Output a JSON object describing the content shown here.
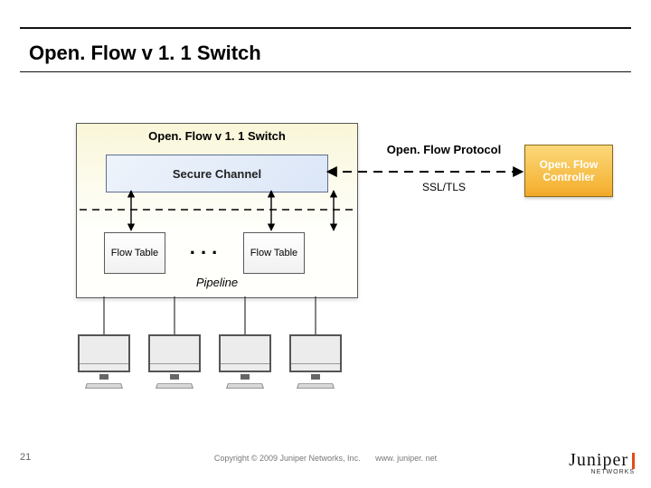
{
  "title": "Open. Flow v 1. 1 Switch",
  "switch": {
    "title": "Open. Flow v 1. 1 Switch",
    "secure_channel": "Secure Channel",
    "flow_table1": "Flow Table",
    "dots": ". . .",
    "flow_table2": "Flow Table",
    "pipeline": "Pipeline"
  },
  "protocol": {
    "label": "Open. Flow Protocol",
    "ssl": "SSL/TLS"
  },
  "controller": "Open. Flow Controller",
  "footer": {
    "page": "21",
    "copyright": "Copyright © 2009 Juniper Networks, Inc.",
    "url": "www. juniper. net",
    "logo_name": "Juniper",
    "logo_sub": "NETWORKS"
  }
}
